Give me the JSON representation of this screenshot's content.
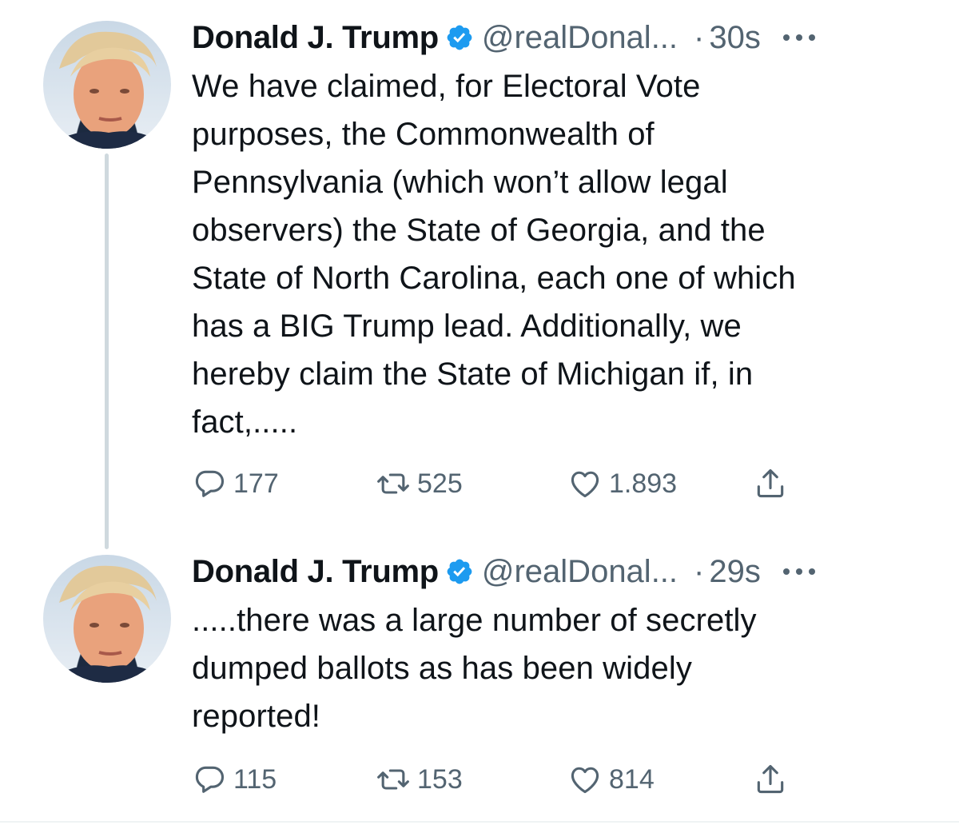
{
  "tweets": [
    {
      "author_name": "Donald J. Trump",
      "handle": "@realDonal...",
      "separator": "·",
      "time": "30s",
      "text": "We have claimed, for Electoral Vote\npurposes, the Commonwealth of\nPennsylvania (which won’t allow legal\nobservers) the State of Georgia, and the\nState of North Carolina, each one of which\nhas a BIG Trump lead. Additionally, we\nhereby claim the State of Michigan if, in\nfact,.....",
      "replies": "177",
      "retweets": "525",
      "likes": "1.893"
    },
    {
      "author_name": "Donald J. Trump",
      "handle": "@realDonal...",
      "separator": "·",
      "time": "29s",
      "text": ".....there was a large number of secretly\ndumped ballots as has been widely\nreported!",
      "replies": "115",
      "retweets": "153",
      "likes": "814"
    }
  ],
  "icons": {
    "avatar": "profile-photo",
    "verified": "verified-badge-icon",
    "more": "more-options-icon",
    "reply": "reply-icon",
    "retweet": "retweet-icon",
    "like": "like-heart-icon",
    "share": "share-icon"
  },
  "colors": {
    "verified_blue": "#1d9bf0",
    "secondary_text": "#536471",
    "thread_line": "#cfd9de"
  }
}
